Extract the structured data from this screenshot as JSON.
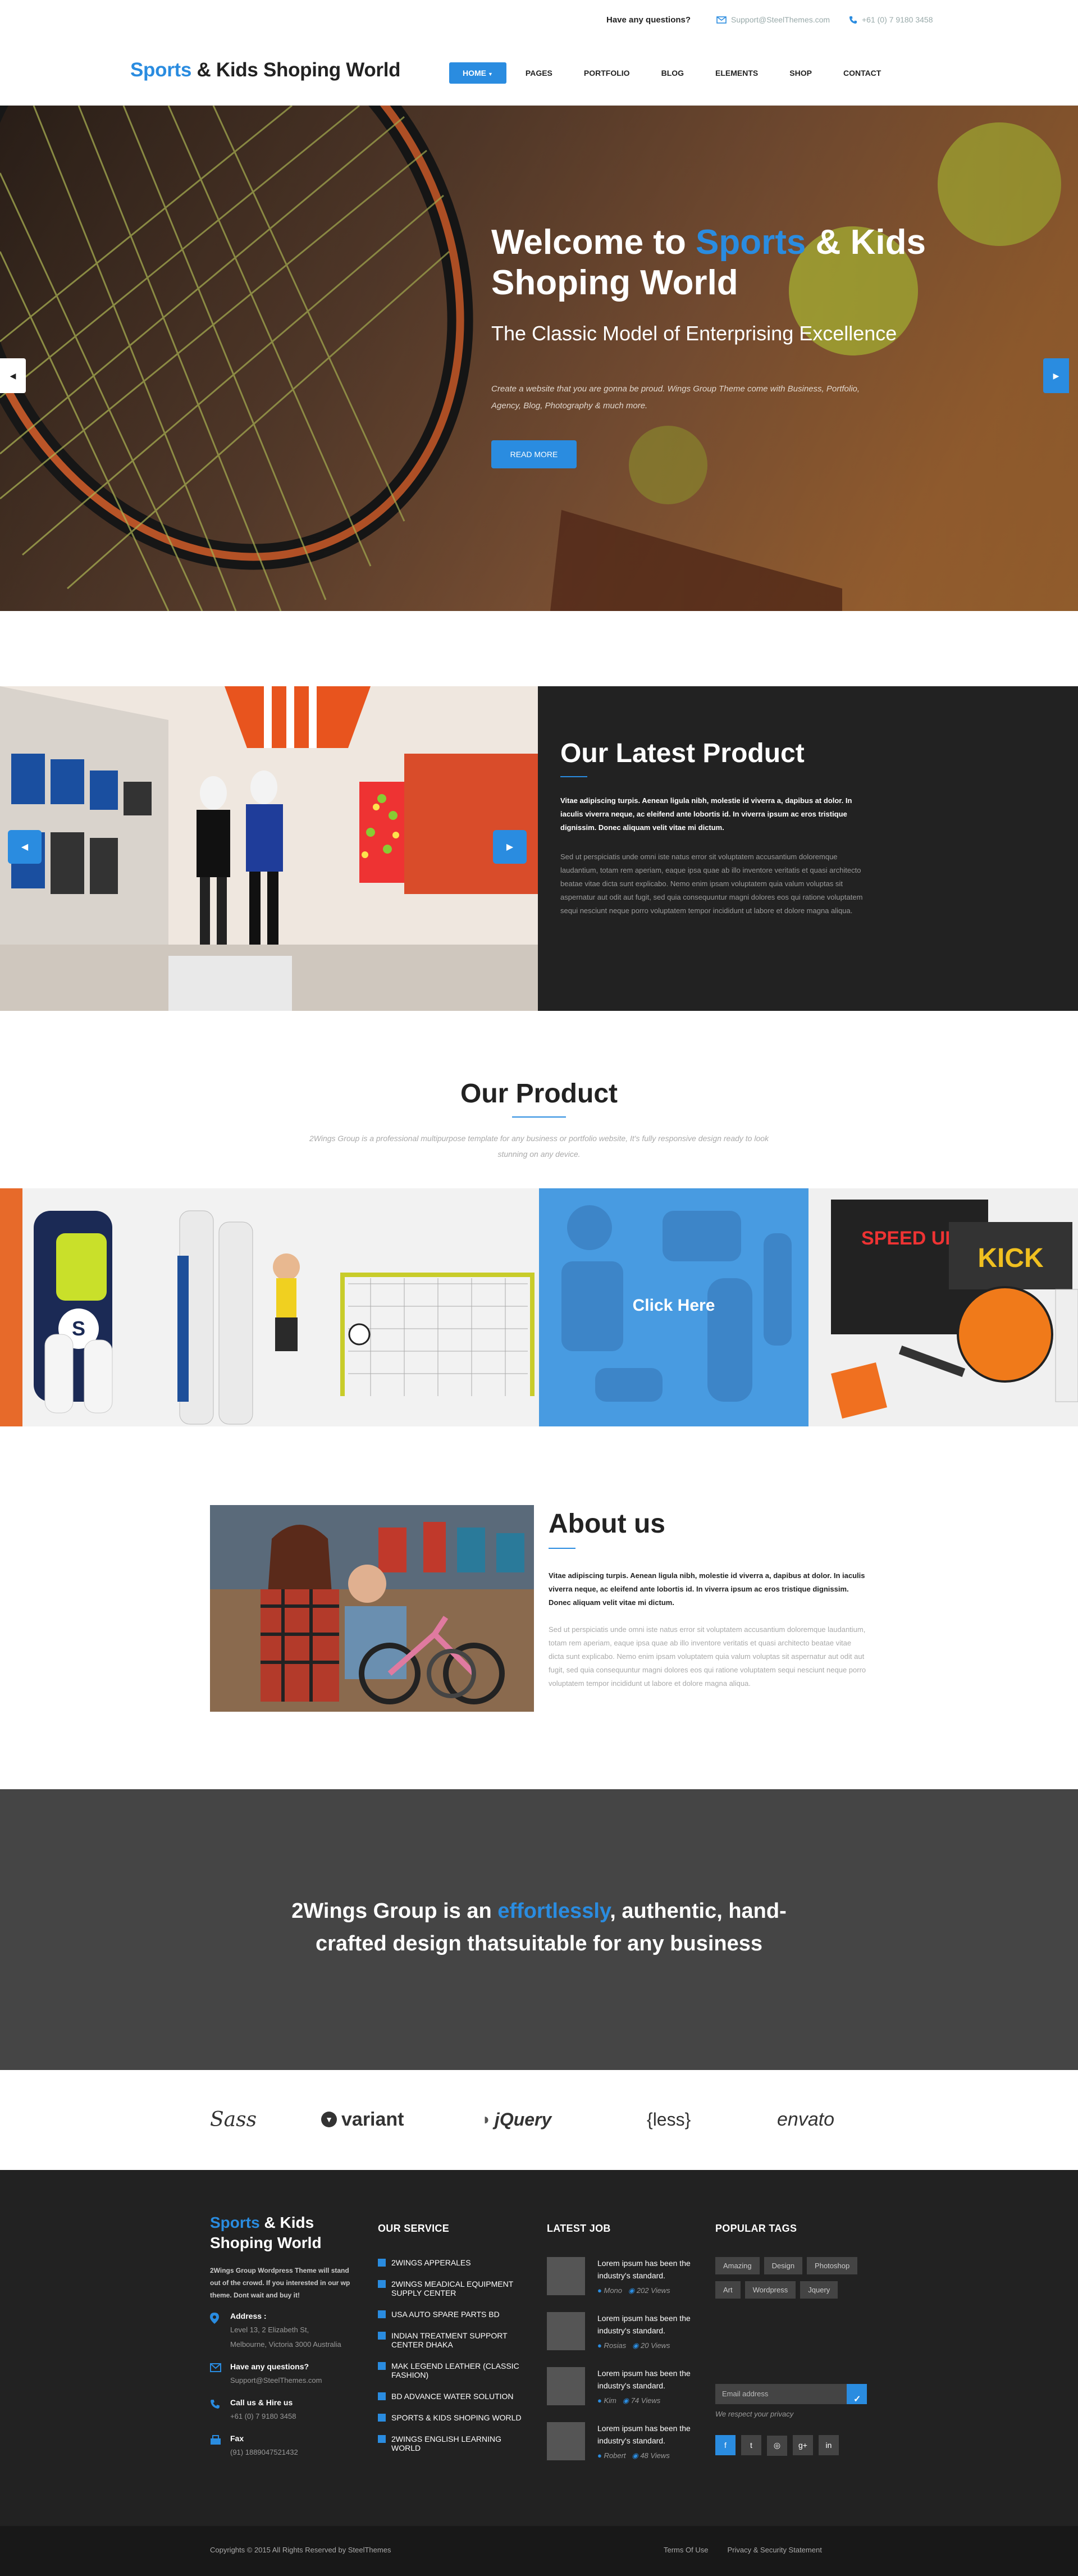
{
  "topbar": {
    "question": "Have any questions?",
    "email": "Support@SteelThemes.com",
    "phone": "+61 (0) 7 9180 3458"
  },
  "header": {
    "logo_accent": "Sports",
    "logo_rest": " & Kids Shoping World",
    "menu": [
      {
        "label": "HOME",
        "active": true
      },
      {
        "label": "PAGES"
      },
      {
        "label": "PORTFOLIO"
      },
      {
        "label": "BLOG"
      },
      {
        "label": "ELEMENTS"
      },
      {
        "label": "SHOP"
      },
      {
        "label": "CONTACT"
      }
    ]
  },
  "hero": {
    "title_pre": "Welcome to ",
    "title_accent": "Sports",
    "title_post": " & Kids Shoping World",
    "subtitle": "The Classic Model of Enterprising Excellence",
    "text": "Create a website that you are gonna be proud. Wings Group Theme come with Business, Portfolio, Agency, Blog, Photography & much more.",
    "button": "READ MORE"
  },
  "latest": {
    "title": "Our Latest Product",
    "lead": "Vitae adipiscing turpis. Aenean ligula nibh, molestie id viverra a, dapibus at dolor. In iaculis viverra neque, ac eleifend ante lobortis id. In viverra ipsum ac eros tristique dignissim. Donec aliquam velit vitae mi dictum.",
    "body": "Sed ut perspiciatis unde omni iste natus error sit voluptatem accusantium doloremque laudantium, totam rem aperiam, eaque ipsa quae ab illo inventore veritatis et quasi architecto beatae vitae dicta sunt explicabo. Nemo enim ipsam voluptatem quia valum voluptas sit aspernatur aut odit aut fugit, sed quia consequuntur magni dolores eos qui ratione voluptatem sequi nesciunt neque porro voluptatem tempor incididunt ut labore et dolore magna aliqua."
  },
  "products": {
    "title": "Our Product",
    "subtitle": "2Wings Group is a professional multipurpose template for any business or portfolio website, It's fully responsive design ready to look stunning on any device.",
    "cta": "Click Here"
  },
  "about": {
    "title": "About us",
    "lead": "Vitae adipiscing turpis. Aenean ligula nibh, molestie id viverra a, dapibus at dolor. In iaculis viverra neque, ac eleifend ante lobortis id. In viverra ipsum ac eros tristique dignissim. Donec aliquam velit vitae mi dictum.",
    "body": "Sed ut perspiciatis unde omni iste natus error sit voluptatem accusantium doloremque laudantium, totam rem aperiam, eaque ipsa quae ab illo inventore veritatis et quasi architecto beatae vitae dicta sunt explicabo. Nemo enim ipsam voluptatem quia valum voluptas sit aspernatur aut odit aut fugit, sed quia consequuntur magni dolores eos qui ratione voluptatem sequi nesciunt neque porro voluptatem tempor incididunt ut labore et dolore magna aliqua."
  },
  "tagline": {
    "pre": "2Wings Group is an ",
    "accent": "effortlessly",
    "post": ", authentic, hand-crafted design thatsuitable for any business"
  },
  "partners": [
    "Sass",
    "variant",
    "jQuery",
    "{less}",
    "envato"
  ],
  "footer": {
    "logo_accent": "Sports",
    "logo_rest": " & Kids Shoping World",
    "description": "2Wings Group Wordpress Theme will stand out of the crowd. If you interested in our wp theme. Dont wait and buy it!",
    "address_title": "Address :",
    "address": "Level 13, 2 Elizabeth St, Melbourne, Victoria 3000 Australia",
    "questions_title": "Have any questions?",
    "questions_value": "Support@SteelThemes.com",
    "call_title": "Call us & Hire us",
    "call_value": "+61 (0) 7 9180 3458",
    "fax_title": "Fax",
    "fax_value": "(91) 1889047521432",
    "service_title": "OUR SERVICE",
    "services": [
      "2WINGS APPERALES",
      "2WINGS MEADICAL EQUIPMENT SUPPLY CENTER",
      "USA AUTO SPARE PARTS BD",
      "INDIAN TREATMENT SUPPORT CENTER DHAKA",
      "MAK LEGEND LEATHER (CLASSIC FASHION)",
      "BD ADVANCE WATER SOLUTION",
      "SPORTS & KIDS SHOPING WORLD",
      "2WINGS ENGLISH LEARNING WORLD"
    ],
    "job_title": "LATEST JOB",
    "jobs": [
      {
        "text": "Lorem ipsum has been the industry's standard.",
        "author": "Mono",
        "views": "202 Views"
      },
      {
        "text": "Lorem ipsum has been the industry's standard.",
        "author": "Rosias",
        "views": "20 Views"
      },
      {
        "text": "Lorem ipsum has been the industry's standard.",
        "author": "Kim",
        "views": "74 Views"
      },
      {
        "text": "Lorem ipsum has been the industry's standard.",
        "author": "Robert",
        "views": "48 Views"
      }
    ],
    "tags_title": "POPULAR TAGS",
    "tags": [
      "Amazing",
      "Design",
      "Photoshop",
      "Art",
      "Wordpress",
      "Jquery"
    ],
    "newsletter_placeholder": "Email address",
    "privacy": "We respect your privacy",
    "social": [
      "f",
      "t",
      "◎",
      "g+",
      "in"
    ]
  },
  "bottom": {
    "copyright": "Copyrights © 2015 All Rights Reserved by SteelThemes",
    "terms": "Terms Of Use",
    "privacy": "Privacy & Security Statement"
  },
  "colors": {
    "accent": "#2a8ce0",
    "dark": "#222222",
    "tagline_bg": "#454545"
  }
}
